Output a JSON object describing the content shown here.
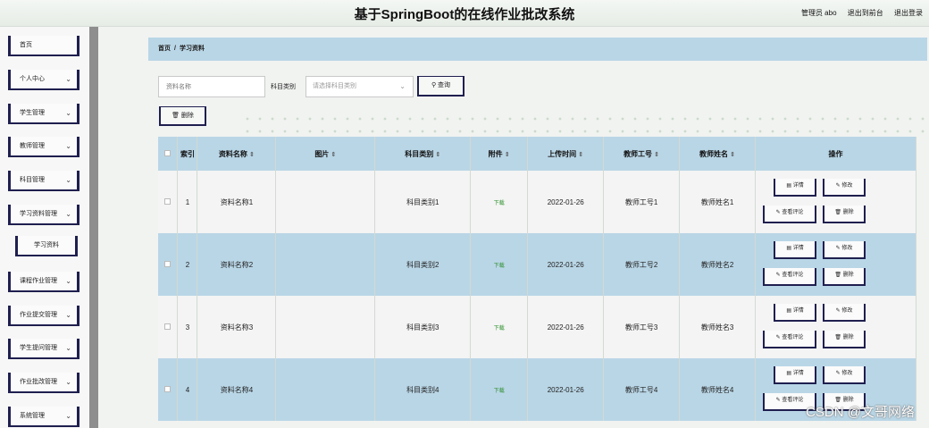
{
  "header": {
    "title": "基于SpringBoot的在线作业批改系统",
    "admin_label": "管理员 abo",
    "frontend_link": "退出到前台",
    "logout_link": "退出登录"
  },
  "sidebar": {
    "items": [
      {
        "label": "首页",
        "has_chevron": false
      },
      {
        "label": "个人中心",
        "has_chevron": true
      },
      {
        "label": "学生管理",
        "has_chevron": true
      },
      {
        "label": "教师管理",
        "has_chevron": true
      },
      {
        "label": "科目管理",
        "has_chevron": true
      },
      {
        "label": "学习资料管理",
        "has_chevron": true
      },
      {
        "label": "学习资料",
        "has_chevron": false,
        "sub": true
      },
      {
        "label": "课程作业管理",
        "has_chevron": true
      },
      {
        "label": "作业提交管理",
        "has_chevron": true
      },
      {
        "label": "学生提问管理",
        "has_chevron": true
      },
      {
        "label": "作业批改管理",
        "has_chevron": true
      },
      {
        "label": "系统管理",
        "has_chevron": true
      }
    ]
  },
  "breadcrumb": {
    "home": "首页",
    "separator": "/",
    "current": "学习资料"
  },
  "search": {
    "name_placeholder": "资料名称",
    "category_label": "科目类别",
    "category_placeholder": "请选择科目类别",
    "query_button": "查询",
    "delete_button": "删除"
  },
  "table": {
    "headers": {
      "index": "索引",
      "name": "资料名称",
      "image": "图片",
      "category": "科目类别",
      "attachment": "附件",
      "upload_time": "上传时间",
      "teacher_id": "教师工号",
      "teacher_name": "教师姓名",
      "actions": "操作"
    },
    "sort_icon": "⇕",
    "rows": [
      {
        "index": "1",
        "name": "资料名称1",
        "image": "",
        "category": "科目类别1",
        "attachment": "下载",
        "upload_time": "2022-01-26",
        "teacher_id": "教师工号1",
        "teacher_name": "教师姓名1"
      },
      {
        "index": "2",
        "name": "资料名称2",
        "image": "",
        "category": "科目类别2",
        "attachment": "下载",
        "upload_time": "2022-01-26",
        "teacher_id": "教师工号2",
        "teacher_name": "教师姓名2"
      },
      {
        "index": "3",
        "name": "资料名称3",
        "image": "",
        "category": "科目类别3",
        "attachment": "下载",
        "upload_time": "2022-01-26",
        "teacher_id": "教师工号3",
        "teacher_name": "教师姓名3"
      },
      {
        "index": "4",
        "name": "资料名称4",
        "image": "",
        "category": "科目类别4",
        "attachment": "下载",
        "upload_time": "2022-01-26",
        "teacher_id": "教师工号4",
        "teacher_name": "教师姓名4"
      }
    ],
    "actions": {
      "detail": "详情",
      "edit": "修改",
      "comment": "查看评论",
      "delete": "删除"
    }
  },
  "watermark": "CSDN @文哥网络",
  "colors": {
    "accent": "#b9d6e6",
    "dark_border": "#1f1f4f",
    "download_link": "#2f8f2f"
  }
}
